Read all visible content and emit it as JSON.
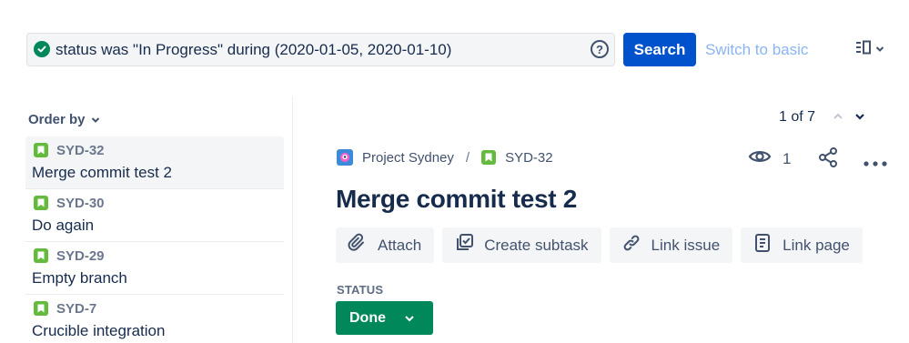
{
  "search": {
    "query": "status was \"In Progress\" during (2020-01-05, 2020-01-10)",
    "help_glyph": "?",
    "button_label": "Search",
    "switch_label": "Switch to basic"
  },
  "sidebar": {
    "order_by_label": "Order by",
    "issues": [
      {
        "key": "SYD-32",
        "summary": "Merge commit test 2",
        "selected": true
      },
      {
        "key": "SYD-30",
        "summary": "Do again",
        "selected": false
      },
      {
        "key": "SYD-29",
        "summary": "Empty branch",
        "selected": false
      },
      {
        "key": "SYD-7",
        "summary": "Crucible integration",
        "selected": false
      }
    ]
  },
  "pager": {
    "text": "1 of 7"
  },
  "issue": {
    "project_name": "Project Sydney",
    "separator": "/",
    "key": "SYD-32",
    "watchers": "1",
    "title": "Merge commit test 2",
    "actions": [
      "Attach",
      "Create subtask",
      "Link issue",
      "Link page"
    ],
    "status_label": "STATUS",
    "status_value": "Done"
  },
  "colors": {
    "primary": "#0052cc",
    "success": "#00875a",
    "story": "#63ba3c",
    "text": "#172b4d",
    "subtle": "#42526e",
    "link_faded": "#8ab4f5"
  },
  "icons": {
    "query_valid": "check-circle-icon",
    "help": "question-circle-icon",
    "view_toggle": "detail-view-icon",
    "issue_type": "story-icon",
    "watch": "eye-icon",
    "share": "share-icon",
    "more": "more-icon",
    "attach": "paperclip-icon",
    "subtask": "subtask-icon",
    "link": "link-icon",
    "page": "page-icon"
  }
}
